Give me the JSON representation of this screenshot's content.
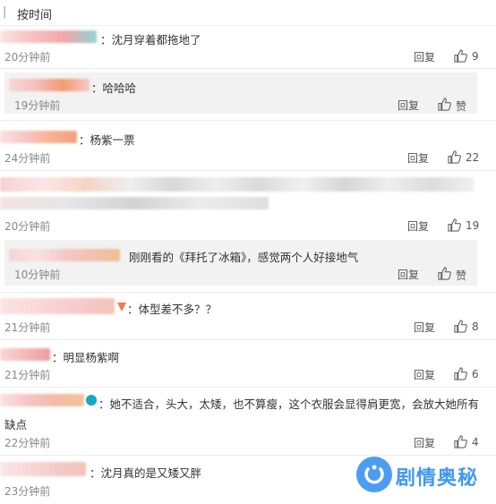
{
  "sort": {
    "separator": "|",
    "label": "按时间"
  },
  "actions": {
    "reply": "回复",
    "like": "赞"
  },
  "comments": [
    {
      "text": "：沈月穿着都拖地了",
      "time": "20分钟前",
      "likes": "9"
    },
    {
      "text": "：哈哈哈",
      "time": "19分钟前",
      "likes": "赞"
    },
    {
      "text": "：杨紫一票",
      "time": "24分钟前",
      "likes": "22"
    },
    {
      "text": "",
      "time": "20分钟前",
      "likes": "19"
    },
    {
      "text": "刚刚看的《拜托了冰箱》，感觉两个人好接地气",
      "time": "10分钟前",
      "likes": "赞"
    },
    {
      "text": "：体型差不多？？",
      "time": "21分钟前",
      "likes": "8"
    },
    {
      "text": "：明显杨紫啊",
      "time": "21分钟前",
      "likes": "6"
    },
    {
      "text": "：她不适合，头大，太矮，也不算瘦，这个衣服会显得肩更宽，会放大她所有",
      "text2": "缺点",
      "time": "22分钟前",
      "likes": "4"
    },
    {
      "text": "：沈月真的是又矮又胖",
      "time": "23分钟前"
    }
  ],
  "watermark": "剧情奥秘"
}
